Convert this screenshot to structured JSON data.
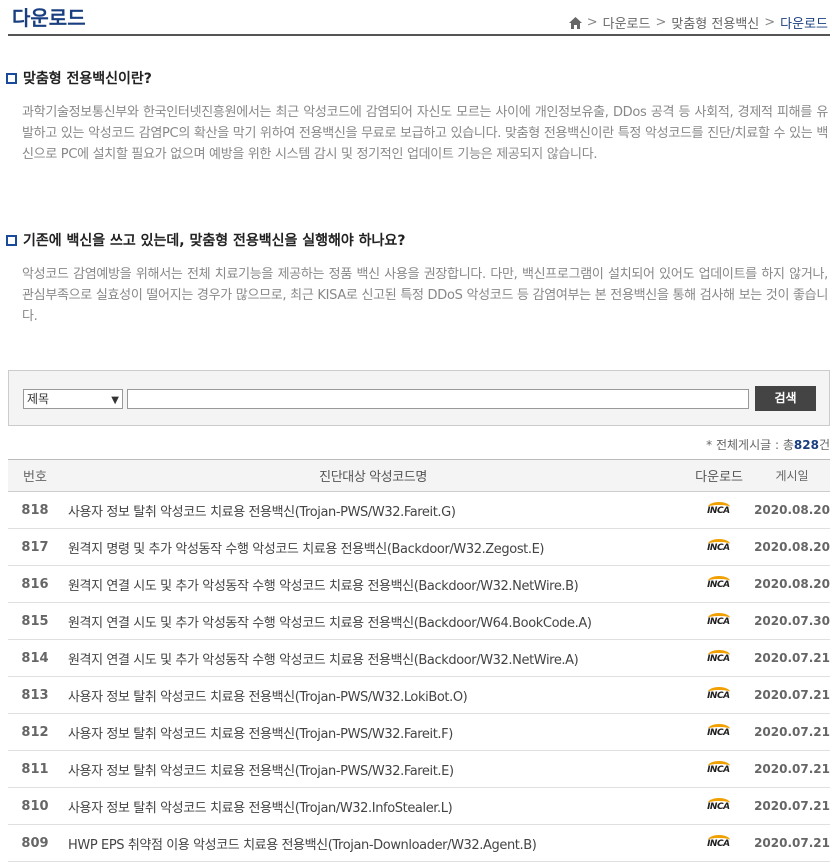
{
  "header": {
    "title": "다운로드",
    "breadcrumb": [
      "다운로드",
      "맞춤형 전용백신",
      "다운로드"
    ]
  },
  "sections": [
    {
      "heading": "맞춤형 전용백신이란?",
      "body": "과학기술정보통신부와 한국인터넷진흥원에서는 최근 악성코드에 감염되어 자신도 모르는 사이에 개인정보유출, DDos 공격 등 사회적, 경제적 피해를 유발하고 있는 악성코드 감염PC의 확산을 막기 위하여 전용백신을 무료로 보급하고 있습니다. 맞춤형 전용백신이란 특정 악성코드를 진단/치료할 수 있는 백신으로 PC에 설치할 필요가 없으며 예방을 위한 시스템 감시 및 정기적인 업데이트 기능은 제공되지 않습니다."
    },
    {
      "heading": "기존에 백신을 쓰고 있는데, 맞춤형 전용백신을 실행해야 하나요?",
      "body": "악성코드 감염예방을 위해서는 전체 치료기능을 제공하는 정품 백신 사용을 권장합니다. 다만, 백신프로그램이 설치되어 있어도 업데이트를 하지 않거나, 관심부족으로 실효성이 떨어지는 경우가 많으므로, 최근 KISA로 신고된 특정 DDoS 악성코드 등 감염여부는 본 전용백신을 통해 검사해 보는 것이 좋습니다."
    }
  ],
  "search": {
    "select_value": "제목",
    "input_value": "",
    "button_label": "검색"
  },
  "total": {
    "prefix": "* 전체게시글 : 총",
    "count": "828",
    "suffix": "건"
  },
  "table": {
    "headers": [
      "번호",
      "진단대상 악성코드명",
      "다운로드",
      "게시일"
    ],
    "download_icon_text": "INCA",
    "rows": [
      {
        "num": "818",
        "title": "사용자 정보 탈취 악성코드 치료용 전용백신(Trojan-PWS/W32.Fareit.G)",
        "date": "2020.08.20"
      },
      {
        "num": "817",
        "title": "원격지 명령 및 추가 악성동작 수행 악성코드 치료용 전용백신(Backdoor/W32.Zegost.E)",
        "date": "2020.08.20"
      },
      {
        "num": "816",
        "title": "원격지 연결 시도 및 추가 악성동작 수행 악성코드 치료용 전용백신(Backdoor/W32.NetWire.B)",
        "date": "2020.08.20"
      },
      {
        "num": "815",
        "title": "원격지 연결 시도 및 추가 악성동작 수행 악성코드 치료용 전용백신(Backdoor/W64.BookCode.A)",
        "date": "2020.07.30"
      },
      {
        "num": "814",
        "title": "원격지 연결 시도 및 추가 악성동작 수행 악성코드 치료용 전용백신(Backdoor/W32.NetWire.A)",
        "date": "2020.07.21"
      },
      {
        "num": "813",
        "title": "사용자 정보 탈취 악성코드 치료용 전용백신(Trojan-PWS/W32.LokiBot.O)",
        "date": "2020.07.21"
      },
      {
        "num": "812",
        "title": "사용자 정보 탈취 악성코드 치료용 전용백신(Trojan-PWS/W32.Fareit.F)",
        "date": "2020.07.21"
      },
      {
        "num": "811",
        "title": "사용자 정보 탈취 악성코드 치료용 전용백신(Trojan-PWS/W32.Fareit.E)",
        "date": "2020.07.21"
      },
      {
        "num": "810",
        "title": "사용자 정보 탈취 악성코드 치료용 전용백신(Trojan/W32.InfoStealer.L)",
        "date": "2020.07.21"
      },
      {
        "num": "809",
        "title": "HWP EPS 취약점 이용 악성코드 치료용 전용백신(Trojan-Downloader/W32.Agent.B)",
        "date": "2020.07.21"
      }
    ]
  },
  "colors": {
    "accent": "#1a3f80",
    "inca_arc": "#f0a000"
  }
}
